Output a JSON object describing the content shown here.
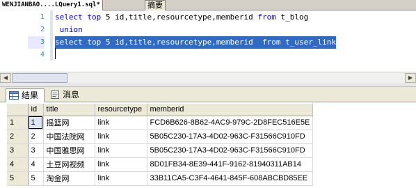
{
  "doc_tabs": {
    "active_tab": "WENJIANBAO....LQuery1.sql*",
    "summary_tab": "摘要"
  },
  "editor": {
    "line_numbers": [
      "1",
      "2",
      "3",
      "4"
    ],
    "lines": [
      {
        "kw1": "select",
        "mid1": " ",
        "kw2": "top",
        "mid2": " 5 id,title,resourcetype,memberid ",
        "kw3": "from",
        "rest": " t_blog"
      },
      {
        "kw1": "union",
        "lead": " "
      },
      {
        "kw1": "select",
        "mid1": " ",
        "kw2": "top",
        "mid2": " 5 id,title,resourcetype,memberid  ",
        "kw3": "from",
        "rest": " t_user_link"
      }
    ]
  },
  "result_tabs": {
    "results_label": "结果",
    "messages_label": "消息"
  },
  "grid": {
    "columns": [
      "id",
      "title",
      "resourcetype",
      "memberid"
    ],
    "rows": [
      {
        "rownum": "1",
        "id": "1",
        "title": "摇篮网",
        "resourcetype": "link",
        "memberid": "FCD6B626-8B62-4AC9-979C-2D8FEC516E5E"
      },
      {
        "rownum": "2",
        "id": "2",
        "title": "中国法院网",
        "resourcetype": "link",
        "memberid": "5B05C230-17A3-4D02-963C-F31566C910FD"
      },
      {
        "rownum": "3",
        "id": "3",
        "title": "中国雅思网",
        "resourcetype": "link",
        "memberid": "5B05C230-17A3-4D02-963C-F31566C910FD"
      },
      {
        "rownum": "4",
        "id": "4",
        "title": "土豆网视频",
        "resourcetype": "link",
        "memberid": "8D01FB34-8E39-441F-9162-81940311AB14"
      },
      {
        "rownum": "5",
        "id": "5",
        "title": "淘金网",
        "resourcetype": "link",
        "memberid": "33B11CA5-C3F4-4641-845F-608ABCBD85EE"
      }
    ]
  }
}
